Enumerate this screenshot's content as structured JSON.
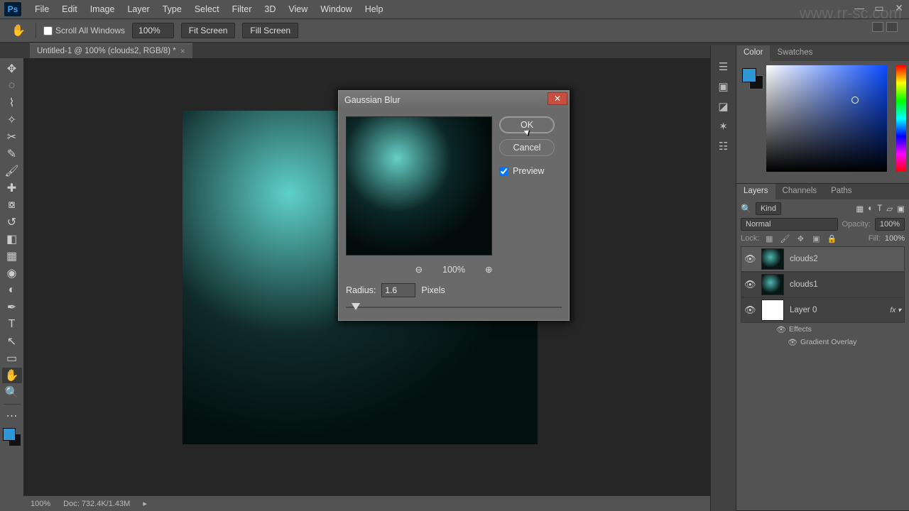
{
  "menu": {
    "items": [
      "File",
      "Edit",
      "Image",
      "Layer",
      "Type",
      "Select",
      "Filter",
      "3D",
      "View",
      "Window",
      "Help"
    ]
  },
  "options": {
    "scroll_all": "Scroll All Windows",
    "zoom": "100%",
    "fit": "Fit Screen",
    "fill": "Fill Screen"
  },
  "doc": {
    "title": "Untitled-1 @ 100% (clouds2, RGB/8) *"
  },
  "dialog": {
    "title": "Gaussian Blur",
    "ok": "OK",
    "cancel": "Cancel",
    "preview": "Preview",
    "zoom": "100%",
    "radius_label": "Radius:",
    "radius_value": "1.6",
    "radius_unit": "Pixels"
  },
  "rightTabs": {
    "color": "Color",
    "swatches": "Swatches",
    "layers": "Layers",
    "channels": "Channels",
    "paths": "Paths"
  },
  "layersPanel": {
    "kind": "Kind",
    "blend": "Normal",
    "opacity_label": "Opacity:",
    "opacity": "100%",
    "lock": "Lock:",
    "fill_label": "Fill:",
    "fill": "100%",
    "layers": [
      {
        "name": "clouds2",
        "sel": true,
        "thumb": "cloud"
      },
      {
        "name": "clouds1",
        "sel": false,
        "thumb": "cloud"
      },
      {
        "name": "Layer 0",
        "sel": false,
        "thumb": "white",
        "fx": true
      }
    ],
    "effects": "Effects",
    "gradient_overlay": "Gradient Overlay"
  },
  "status": {
    "zoom": "100%",
    "doc": "Doc: 732.4K/1.43M"
  },
  "watermark_url": "www.rr-sc.com"
}
